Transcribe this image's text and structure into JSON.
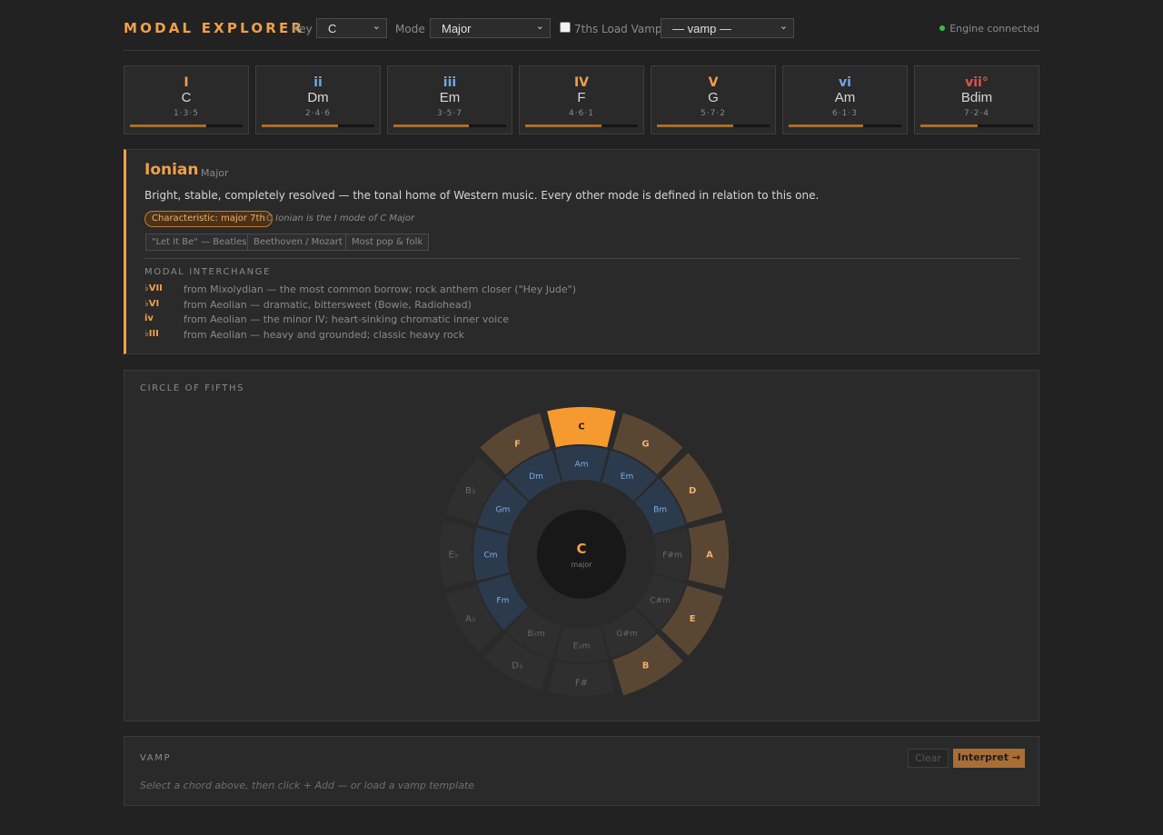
{
  "header": {
    "app_title": "MODAL EXPLORER",
    "key_label": "Key",
    "key_value": "C",
    "mode_label": "Mode",
    "mode_value": "Major",
    "sevenths_label": "7ths",
    "vamp_label": "Load Vamp",
    "vamp_value": "— vamp —",
    "engine_status": "Engine connected",
    "engine_color": "#3dbb4a"
  },
  "chords": [
    {
      "numeral": "I",
      "name": "C",
      "tones": "1·3·5",
      "fill": 0.68,
      "color": "#f2a04a"
    },
    {
      "numeral": "ii",
      "name": "Dm",
      "tones": "2·4·6",
      "fill": 0.68,
      "color": "#6ea8e6"
    },
    {
      "numeral": "iii",
      "name": "Em",
      "tones": "3·5·7",
      "fill": 0.67,
      "color": "#6ea8e6"
    },
    {
      "numeral": "IV",
      "name": "F",
      "tones": "4·6·1",
      "fill": 0.68,
      "color": "#f2a04a"
    },
    {
      "numeral": "V",
      "name": "G",
      "tones": "5·7·2",
      "fill": 0.68,
      "color": "#f2a04a"
    },
    {
      "numeral": "vi",
      "name": "Am",
      "tones": "6·1·3",
      "fill": 0.66,
      "color": "#6ea8e6"
    },
    {
      "numeral": "vii°",
      "name": "Bdim",
      "tones": "7·2·4",
      "fill": 0.51,
      "color": "#e0524f"
    }
  ],
  "mode": {
    "title": "Ionian",
    "subtitle": "Major",
    "description": "Bright, stable, completely resolved — the tonal home of Western music. Every other mode is defined in relation to this one.",
    "characteristic": "Characteristic: major 7th",
    "note": "C Ionian is the I mode of C Major",
    "tags": [
      "\"Let It Be\" — Beatles",
      "Beethoven / Mozart",
      "Most pop & folk"
    ],
    "interchange_heading": "MODAL INTERCHANGE",
    "interchange": [
      {
        "numeral": "♭VII",
        "text": "from Mixolydian — the most common borrow; rock anthem closer (\"Hey Jude\")"
      },
      {
        "numeral": "♭VI",
        "text": "from Aeolian — dramatic, bittersweet (Bowie, Radiohead)"
      },
      {
        "numeral": "iv",
        "text": "from Aeolian — the minor IV; heart-sinking chromatic inner voice"
      },
      {
        "numeral": "♭III",
        "text": "from Aeolian — heavy and grounded; classic heavy rock"
      }
    ]
  },
  "circle": {
    "heading": "CIRCLE OF FIFTHS",
    "center_key": "C",
    "center_quality": "major",
    "outer": [
      {
        "label": "C",
        "state": "selected"
      },
      {
        "label": "G",
        "state": "diatonic"
      },
      {
        "label": "D",
        "state": "diatonic"
      },
      {
        "label": "A",
        "state": "diatonic"
      },
      {
        "label": "E",
        "state": "diatonic"
      },
      {
        "label": "B",
        "state": "diatonic"
      },
      {
        "label": "F#",
        "state": "off"
      },
      {
        "label": "D♭",
        "state": "off"
      },
      {
        "label": "A♭",
        "state": "off"
      },
      {
        "label": "E♭",
        "state": "off"
      },
      {
        "label": "B♭",
        "state": "off"
      },
      {
        "label": "F",
        "state": "diatonic"
      }
    ],
    "inner": [
      {
        "label": "Am",
        "state": "minor"
      },
      {
        "label": "Em",
        "state": "minor"
      },
      {
        "label": "Bm",
        "state": "minor"
      },
      {
        "label": "F#m",
        "state": "off"
      },
      {
        "label": "C#m",
        "state": "off"
      },
      {
        "label": "G#m",
        "state": "off"
      },
      {
        "label": "E♭m",
        "state": "off"
      },
      {
        "label": "B♭m",
        "state": "off"
      },
      {
        "label": "Fm",
        "state": "minor"
      },
      {
        "label": "Cm",
        "state": "minor"
      },
      {
        "label": "Gm",
        "state": "minor"
      },
      {
        "label": "Dm",
        "state": "minor"
      }
    ],
    "colors": {
      "selected_fill": "#f59a2e",
      "diatonic_fill": "#5a4733",
      "minor_fill": "#2c3a4d",
      "off_fill": "#2f2f2f",
      "diatonic_text": "#f2b06a",
      "minor_text": "#7fb0e6",
      "off_text": "#6a6a6a"
    }
  },
  "vamp": {
    "heading": "VAMP",
    "hint": "Select a chord above, then click + Add — or load a vamp template",
    "clear_label": "Clear",
    "interpret_label": "Interpret →"
  }
}
